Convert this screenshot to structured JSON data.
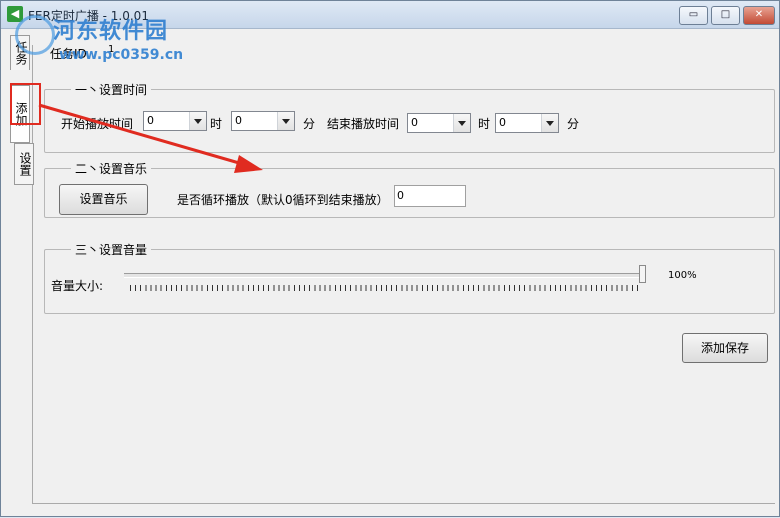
{
  "window": {
    "title": "FER定时广播 - 1.0.01",
    "min_glyph": "▭",
    "max_glyph": "□",
    "close_glyph": "✕"
  },
  "watermark": {
    "name": "河东软件园",
    "url": "www.pc0359.cn"
  },
  "tabs": {
    "id_tab": "任务",
    "add_tab": "添加",
    "settings_tab": "设置"
  },
  "task": {
    "label": "任务ID",
    "value": "1"
  },
  "section_time": {
    "legend": "一丶设置时间",
    "start_label": "开始播放时间",
    "start_hour": "0",
    "hour_label1": "时",
    "start_minute": "0",
    "minute_label1": "分",
    "end_label": "结束播放时间",
    "end_hour": "0",
    "hour_label2": "时",
    "end_minute": "0",
    "minute_label2": "分"
  },
  "section_music": {
    "legend": "二丶设置音乐",
    "button_label": "设置音乐",
    "loop_label": "是否循环播放（默认0循环到结束播放）",
    "loop_value": "0"
  },
  "section_volume": {
    "legend": "三丶设置音量",
    "volume_label": "音量大小:",
    "volume_percent_text": "100%",
    "volume_level": 1.0
  },
  "actions": {
    "save_label": "添加保存"
  },
  "colors": {
    "annotation_red": "#e02b20",
    "watermark_blue": "#2f7fd0"
  }
}
